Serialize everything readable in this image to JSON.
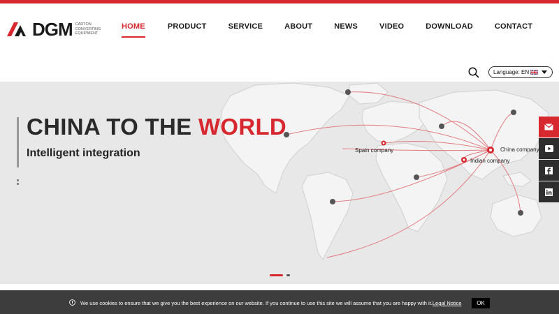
{
  "brand": {
    "name": "DGM",
    "tagline_1": "CARTON",
    "tagline_2": "CONVERTING",
    "tagline_3": "EQUIPMENT",
    "accent": "#d7282f"
  },
  "nav": {
    "items": [
      {
        "label": "HOME",
        "active": true
      },
      {
        "label": "PRODUCT",
        "active": false
      },
      {
        "label": "SERVICE",
        "active": false
      },
      {
        "label": "ABOUT",
        "active": false
      },
      {
        "label": "NEWS",
        "active": false
      },
      {
        "label": "VIDEO",
        "active": false
      },
      {
        "label": "DOWNLOAD",
        "active": false
      },
      {
        "label": "CONTACT",
        "active": false
      }
    ]
  },
  "header": {
    "search_icon": "search-icon",
    "language_label": "Language: EN",
    "language_flag": "uk-flag-icon"
  },
  "hero": {
    "title_part1": "CHINA TO THE ",
    "title_part2": "WORLD",
    "subtitle": "Intelligent integration",
    "labels": {
      "spain": "Spain company",
      "china": "China company",
      "india": "Indian company"
    },
    "slide_count": 2,
    "active_slide": 1
  },
  "side_bar": {
    "icons": [
      "mail-icon",
      "youtube-icon",
      "facebook-icon",
      "linkedin-icon"
    ]
  },
  "cookie": {
    "message": "We use cookies to ensure that we give you the best experience on our website. If you continue to use this site we will assume that you are happy with it.",
    "legal_link": "Legal Notice",
    "ok_label": "OK"
  }
}
